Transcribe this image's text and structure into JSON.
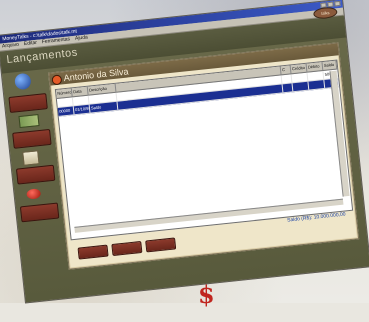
{
  "window": {
    "title": "MoneyTalks - c:\\talk\\dados\\talk.mt",
    "menu": [
      "Arquivo",
      "Editar",
      "Ferramentas",
      "Ajuda"
    ]
  },
  "app": {
    "page_title": "Lançamentos",
    "logo_text": "talks"
  },
  "sidebar": {
    "buttons": [
      "",
      "",
      "",
      "",
      "",
      ""
    ]
  },
  "account": {
    "name": "Antonio da Silva"
  },
  "table": {
    "columns": [
      "Número",
      "Data",
      "Descrição",
      "",
      "C",
      "Crédito",
      "Débito",
      "Saldo"
    ],
    "rows": [
      [
        "",
        "",
        "",
        "",
        "",
        "",
        "",
        "50000"
      ],
      [
        "00000",
        "01/10/98",
        "Saldo",
        "",
        "",
        "",
        "",
        ""
      ]
    ]
  },
  "footer": {
    "saldo_text": "Saldo (R$): 10.000.000,00"
  },
  "colors": {
    "titlebar": "#1d2a7a",
    "selection": "#1b2f92",
    "saldo": "#173fa5"
  }
}
